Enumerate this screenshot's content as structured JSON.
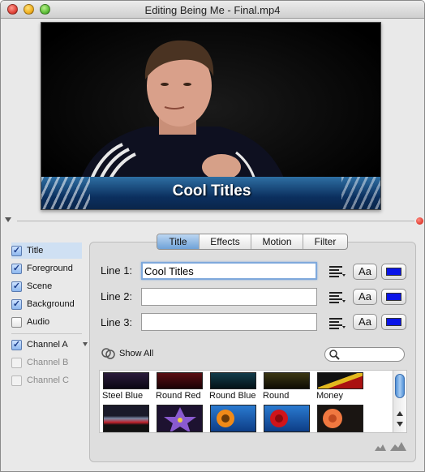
{
  "window": {
    "title": "Editing Being Me - Final.mp4"
  },
  "video": {
    "caption": "Cool Titles"
  },
  "layers": [
    {
      "label": "Title",
      "checked": true,
      "selected": true,
      "enabled": true
    },
    {
      "label": "Foreground",
      "checked": true,
      "enabled": true
    },
    {
      "label": "Scene",
      "checked": true,
      "enabled": true
    },
    {
      "label": "Background",
      "checked": true,
      "enabled": true
    },
    {
      "label": "Audio",
      "checked": false,
      "enabled": true
    }
  ],
  "channels": [
    {
      "label": "Channel A",
      "checked": true,
      "enabled": true
    },
    {
      "label": "Channel B",
      "checked": false,
      "enabled": false
    },
    {
      "label": "Channel C",
      "checked": false,
      "enabled": false
    }
  ],
  "tabs": [
    {
      "label": "Title",
      "active": true
    },
    {
      "label": "Effects"
    },
    {
      "label": "Motion"
    },
    {
      "label": "Filter"
    }
  ],
  "lines": [
    {
      "label": "Line 1:",
      "value": "Cool Titles",
      "color": "#0a14e8",
      "font_btn": "Aa"
    },
    {
      "label": "Line 2:",
      "value": "",
      "color": "#0a14e8",
      "font_btn": "Aa"
    },
    {
      "label": "Line 3:",
      "value": "",
      "color": "#0a14e8",
      "font_btn": "Aa"
    }
  ],
  "show_all": {
    "label": "Show All"
  },
  "search": {
    "value": ""
  },
  "styles": [
    {
      "label": "Steel Blue"
    },
    {
      "label": "Round Red"
    },
    {
      "label": "Round Blue"
    },
    {
      "label": "Round"
    },
    {
      "label": "Money"
    }
  ],
  "colors": {
    "accent": "#6fa2d8",
    "swatch": "#0a14e8",
    "window_bg": "#e9e9e9"
  }
}
